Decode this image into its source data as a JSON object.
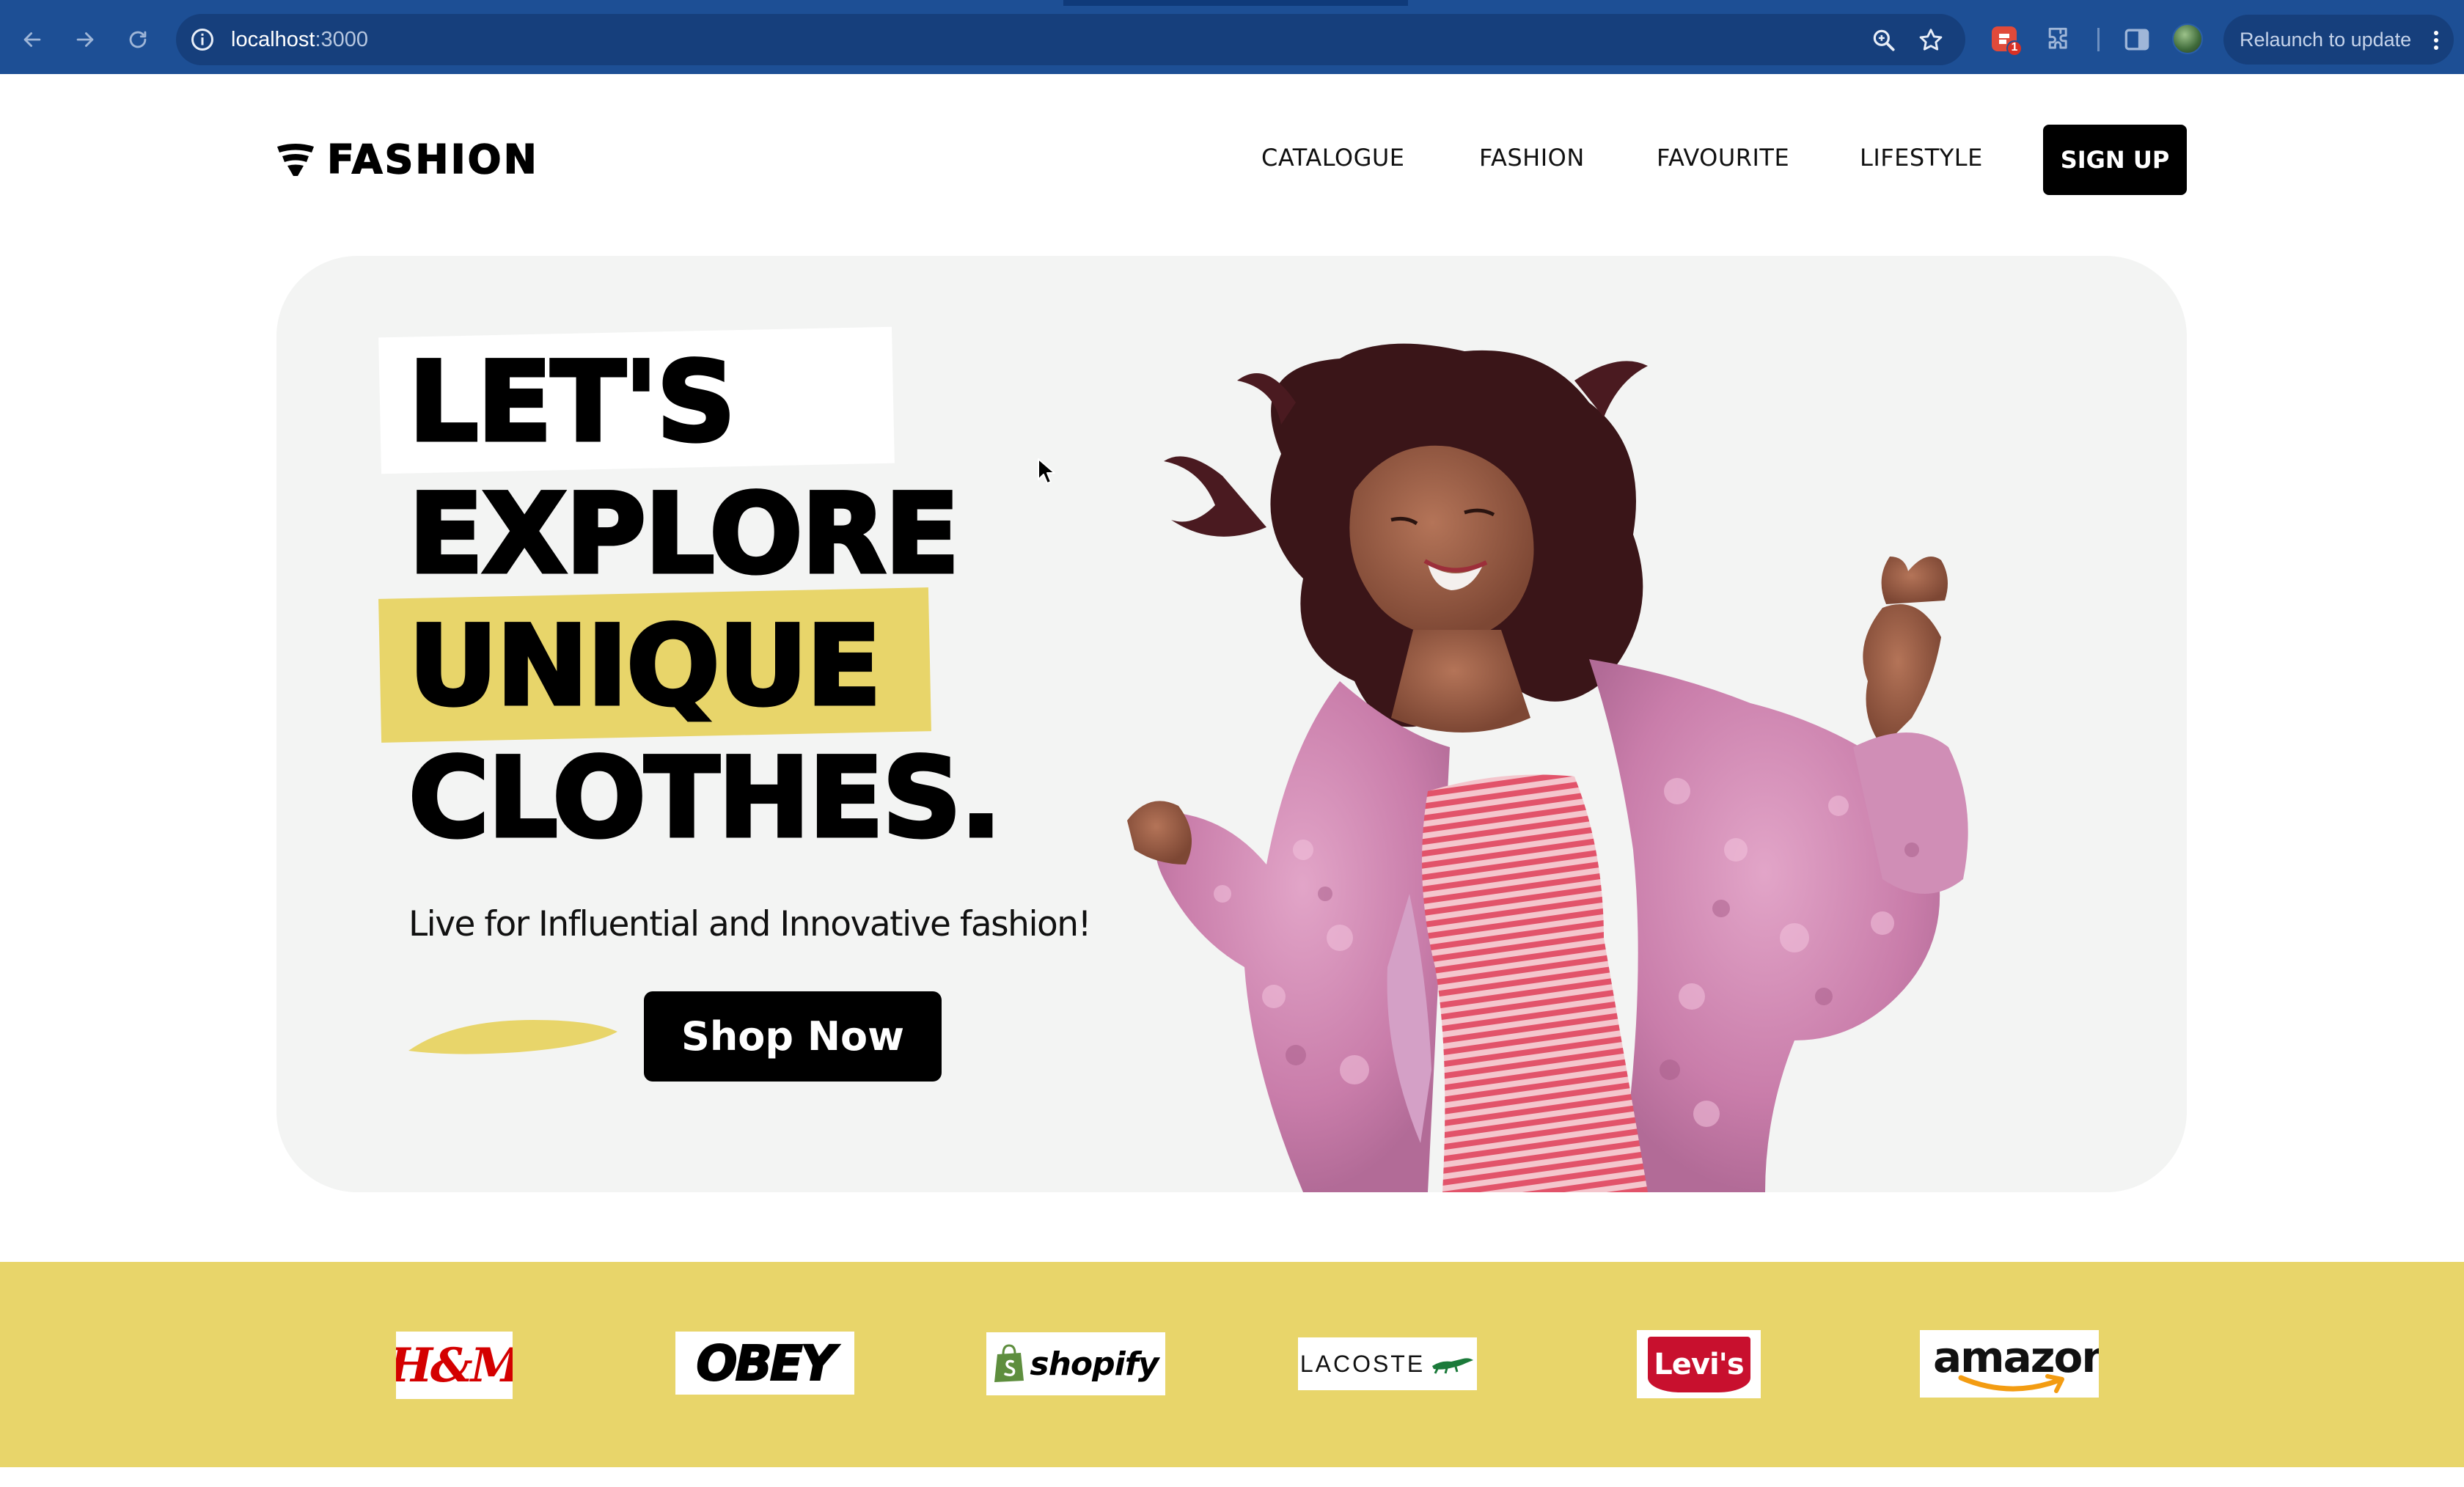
{
  "browser": {
    "url_host": "localhost",
    "url_port": ":3000",
    "relaunch_label": "Relaunch to update",
    "extension_badge": "1",
    "accent": "#1d4f95"
  },
  "site": {
    "logo_text": "FASHION",
    "nav": [
      "CATALOGUE",
      "FASHION",
      "FAVOURITE",
      "LIFESTYLE"
    ],
    "signup_label": "SIGN UP"
  },
  "hero": {
    "lines": [
      "LET'S",
      "EXPLORE",
      "UNIQUE",
      "CLOTHES."
    ],
    "subtitle": "Live for Influential and Innovative fashion!",
    "cta_label": "Shop Now",
    "accent_yellow": "#e8d56a",
    "background": "#f3f4f3"
  },
  "brands": {
    "background": "#e8d56a",
    "items": [
      {
        "name": "H&M",
        "text": "H&M"
      },
      {
        "name": "OBEY",
        "text": "OBEY"
      },
      {
        "name": "shopify",
        "text": "shopify"
      },
      {
        "name": "LACOSTE",
        "text": "LACOSTE"
      },
      {
        "name": "Levi's",
        "text": "Levi's"
      },
      {
        "name": "amazon",
        "text": "amazon"
      }
    ]
  }
}
